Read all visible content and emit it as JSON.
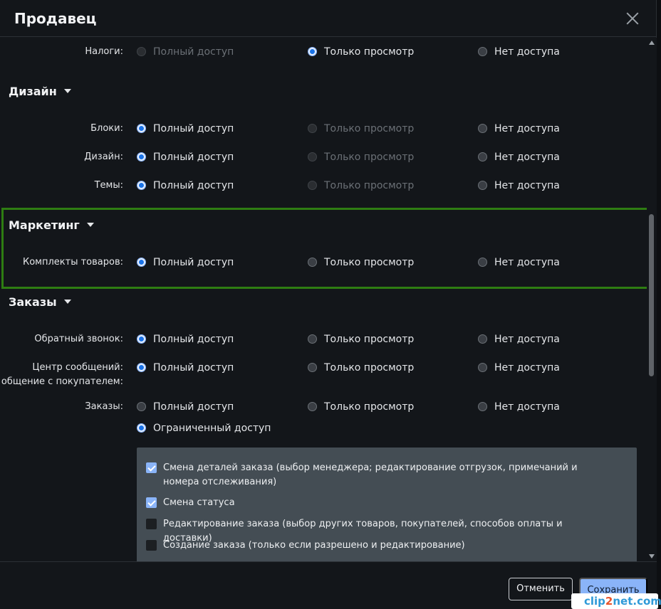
{
  "dialog": {
    "title": "Продавец"
  },
  "options": {
    "full": "Полный доступ",
    "view": "Только просмотр",
    "none": "Нет доступа",
    "limited": "Ограниченный доступ"
  },
  "sections": {
    "taxes_row": {
      "label": "Налоги:",
      "selected": "view",
      "disabled": [
        "full"
      ]
    },
    "design": {
      "title": "Дизайн",
      "rows": [
        {
          "label": "Блоки:",
          "selected": "full",
          "disabled": [
            "view"
          ]
        },
        {
          "label": "Дизайн:",
          "selected": "full",
          "disabled": [
            "view"
          ]
        },
        {
          "label": "Темы:",
          "selected": "full",
          "disabled": [
            "view"
          ]
        }
      ]
    },
    "marketing": {
      "title": "Маркетинг",
      "rows": [
        {
          "label": "Комплекты товаров:",
          "selected": "full"
        }
      ]
    },
    "orders": {
      "title": "Заказы",
      "rows": [
        {
          "label": "Обратный звонок:",
          "selected": "full"
        },
        {
          "label1": "Центр сообщений:",
          "label2": "общение с покупателем:",
          "selected": "full"
        },
        {
          "label": "Заказы:",
          "selected": "limited"
        }
      ],
      "permissions": [
        {
          "text": "Смена деталей заказа (выбор менеджера; редактирование отгрузок, примечаний и номера отслеживания)",
          "checked": true
        },
        {
          "text": "Смена статуса",
          "checked": true
        },
        {
          "text": "Редактирование заказа (выбор других товаров, покупателей, способов оплаты и доставки)",
          "checked": false
        },
        {
          "text": "Создание заказа (только если разрешено и редактирование)",
          "checked": false
        }
      ]
    }
  },
  "footer": {
    "cancel_label": "Отменить",
    "save_label": "Сохранить"
  },
  "watermark": {
    "part1": "clip",
    "part2": "2",
    "part3": "net.com"
  }
}
